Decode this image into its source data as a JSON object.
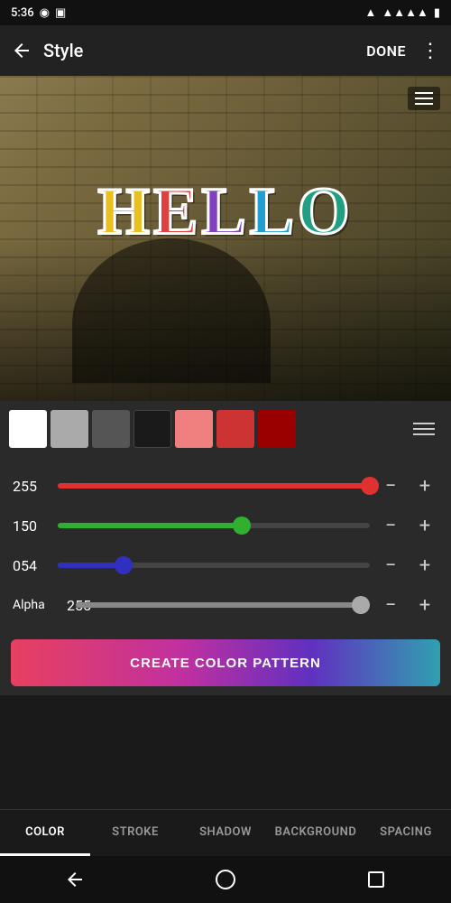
{
  "statusBar": {
    "time": "5:36",
    "batteryIcon": "battery-icon",
    "wifiIcon": "wifi-icon",
    "signalIcon": "signal-icon"
  },
  "appBar": {
    "backLabel": "←",
    "title": "Style",
    "doneLabel": "DONE",
    "moreLabel": "⋮"
  },
  "preview": {
    "helloLetters": [
      "H",
      "E",
      "L",
      "L",
      "O"
    ],
    "menuIcon": "menu-icon"
  },
  "colorSwatches": [
    {
      "id": "white",
      "color": "#ffffff",
      "selected": true
    },
    {
      "id": "lightgray",
      "color": "#aaaaaa",
      "selected": false
    },
    {
      "id": "darkgray",
      "color": "#555555",
      "selected": false
    },
    {
      "id": "black",
      "color": "#1a1a1a",
      "selected": false
    },
    {
      "id": "lightred",
      "color": "#f08080",
      "selected": false
    },
    {
      "id": "red",
      "color": "#cc3333",
      "selected": false
    },
    {
      "id": "darkred",
      "color": "#990000",
      "selected": false
    }
  ],
  "sliders": {
    "red": {
      "label": "255",
      "value": 255,
      "percent": 100
    },
    "green": {
      "label": "150",
      "value": 150,
      "percent": 59
    },
    "blue": {
      "label": "054",
      "value": 54,
      "percent": 21
    },
    "alpha": {
      "label": "255",
      "alphaLabel": "Alpha",
      "value": 255,
      "percent": 97
    }
  },
  "createButton": {
    "label": "CREATE COLOR PATTERN"
  },
  "tabs": [
    {
      "id": "color",
      "label": "COLOR",
      "active": true
    },
    {
      "id": "stroke",
      "label": "STROKE",
      "active": false
    },
    {
      "id": "shadow",
      "label": "SHADOW",
      "active": false
    },
    {
      "id": "background",
      "label": "BACKGROUND",
      "active": false
    },
    {
      "id": "spacing",
      "label": "SPACING",
      "active": false
    }
  ],
  "buttons": {
    "minus": "−",
    "plus": "+"
  }
}
